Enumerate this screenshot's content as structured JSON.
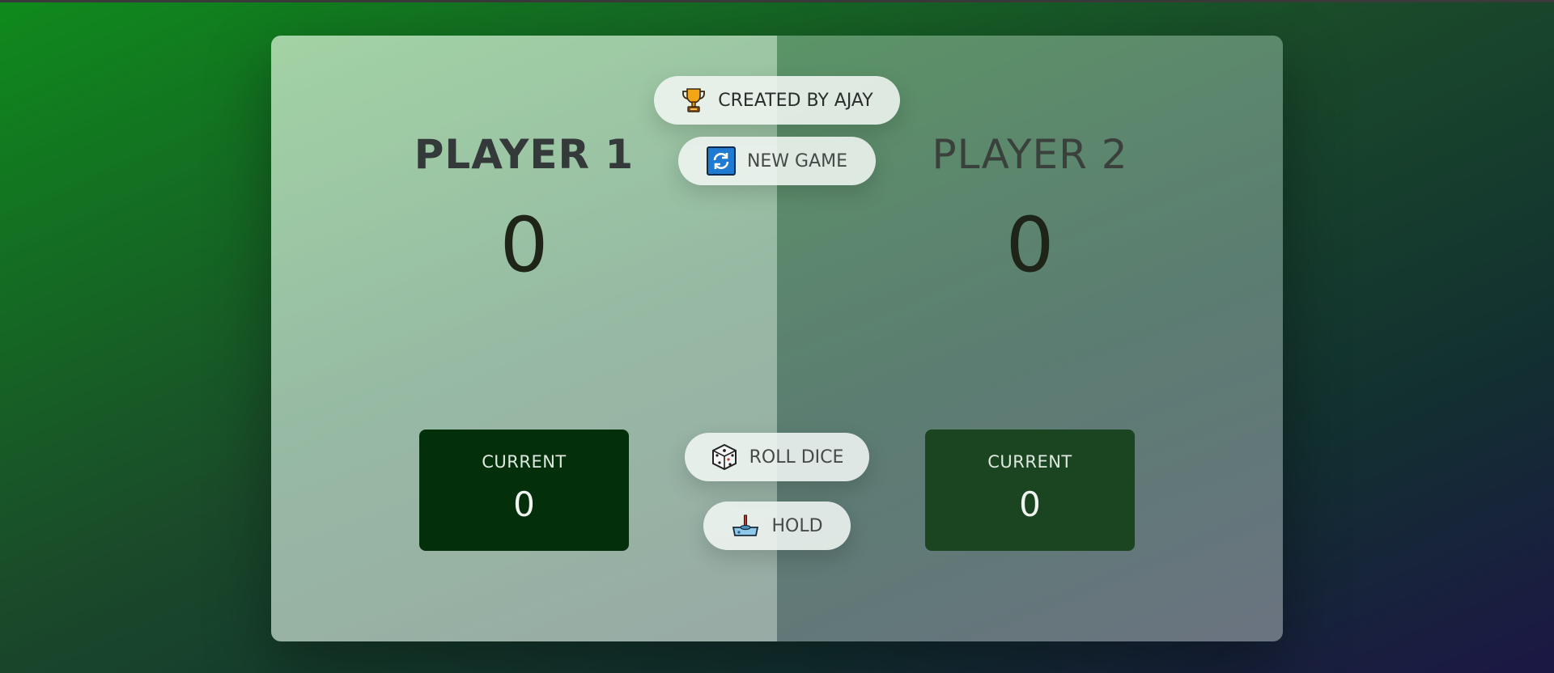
{
  "player1": {
    "name": "PLAYER 1",
    "score": "0",
    "current_label": "CURRENT",
    "current_score": "0"
  },
  "player2": {
    "name": "PLAYER 2",
    "score": "0",
    "current_label": "CURRENT",
    "current_score": "0"
  },
  "buttons": {
    "credit": {
      "label": "CREATED BY AJAY",
      "icon": "trophy-icon"
    },
    "new_game": {
      "label": "NEW GAME",
      "icon": "refresh-icon"
    },
    "roll_dice": {
      "label": "ROLL DICE",
      "icon": "dice-icon"
    },
    "hold": {
      "label": "HOLD",
      "icon": "joystick-icon"
    }
  },
  "colors": {
    "active_current_bg": "#03300a",
    "inactive_current_bg": "#1b4421"
  }
}
